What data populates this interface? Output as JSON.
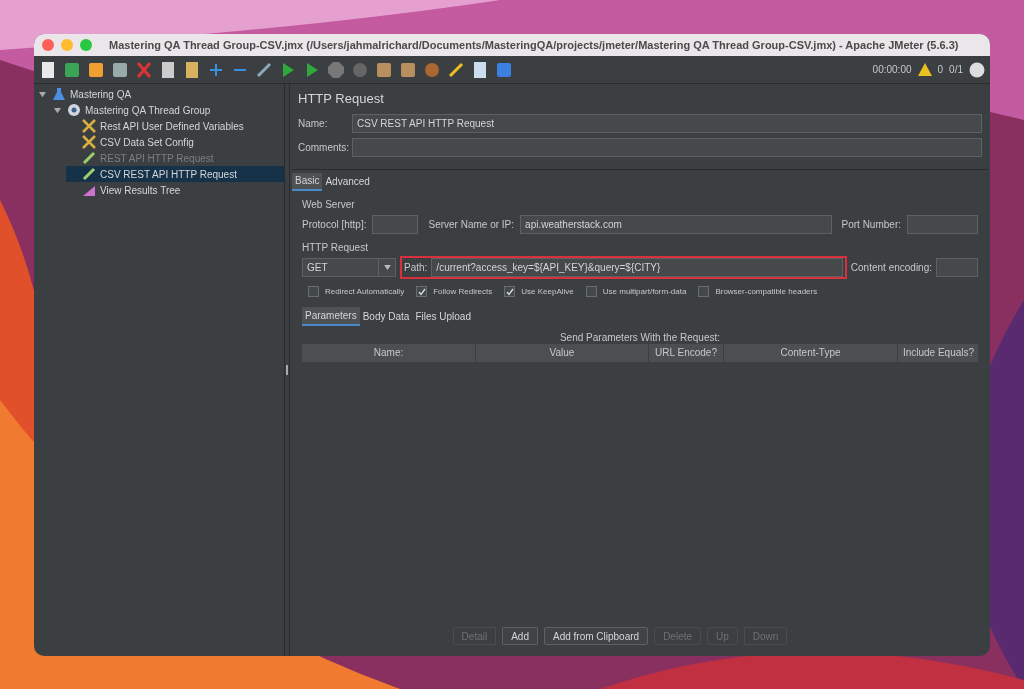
{
  "window": {
    "title": "Mastering QA Thread Group-CSV.jmx (/Users/jahmalrichard/Documents/MasteringQA/projects/jmeter/Mastering QA Thread Group-CSV.jmx) - Apache JMeter (5.6.3)"
  },
  "toolbar": {
    "timer": "00:00:00",
    "warnings": "0",
    "threads": "0/1"
  },
  "tree": [
    {
      "label": "Mastering QA",
      "kind": "plan",
      "expanded": true,
      "selected": false,
      "disabled": false,
      "children": [
        {
          "label": "Mastering QA Thread Group",
          "kind": "threads",
          "expanded": true,
          "selected": false,
          "disabled": false,
          "children": [
            {
              "label": "Rest API User Defined Variables",
              "kind": "config",
              "selected": false,
              "disabled": false
            },
            {
              "label": "CSV Data Set Config",
              "kind": "config",
              "selected": false,
              "disabled": false
            },
            {
              "label": "REST API HTTP Request",
              "kind": "sampler",
              "selected": false,
              "disabled": true
            },
            {
              "label": "CSV REST API HTTP Request",
              "kind": "sampler",
              "selected": true,
              "disabled": false
            },
            {
              "label": "View Results Tree",
              "kind": "listener",
              "selected": false,
              "disabled": false
            }
          ]
        }
      ]
    }
  ],
  "panel": {
    "heading": "HTTP Request",
    "name_label": "Name:",
    "name_value": "CSV REST API HTTP Request",
    "comments_label": "Comments:"
  },
  "tabs": [
    {
      "label": "Basic",
      "selected": true
    },
    {
      "label": "Advanced",
      "selected": false
    }
  ],
  "web_server": {
    "legend": "Web Server",
    "protocol_label": "Protocol [http]:",
    "server_label": "Server Name or IP:",
    "server_value": "api.weatherstack.com",
    "port_label": "Port Number:"
  },
  "http_request": {
    "legend": "HTTP Request",
    "method": "GET",
    "path_label": "Path:",
    "path_value": "/current?access_key=${API_KEY}&query=${CITY}",
    "highlighted": true,
    "encoding_label": "Content encoding:"
  },
  "options": [
    {
      "label": "Redirect Automatically",
      "checked": false
    },
    {
      "label": "Follow Redirects",
      "checked": true
    },
    {
      "label": "Use KeepAlive",
      "checked": true
    },
    {
      "label": "Use multipart/form-data",
      "checked": false
    },
    {
      "label": "Browser-compatible headers",
      "checked": false
    }
  ],
  "subtabs": [
    {
      "label": "Parameters",
      "selected": true
    },
    {
      "label": "Body Data",
      "selected": false
    },
    {
      "label": "Files Upload",
      "selected": false
    }
  ],
  "parameters": {
    "caption": "Send Parameters With the Request:",
    "columns": [
      "Name:",
      "Value",
      "URL Encode?",
      "Content-Type",
      "Include Equals?"
    ]
  },
  "buttons": [
    {
      "label": "Detail",
      "disabled": true
    },
    {
      "label": "Add",
      "disabled": false
    },
    {
      "label": "Add from Clipboard",
      "disabled": false
    },
    {
      "label": "Delete",
      "disabled": true
    },
    {
      "label": "Up",
      "disabled": true
    },
    {
      "label": "Down",
      "disabled": true
    }
  ]
}
